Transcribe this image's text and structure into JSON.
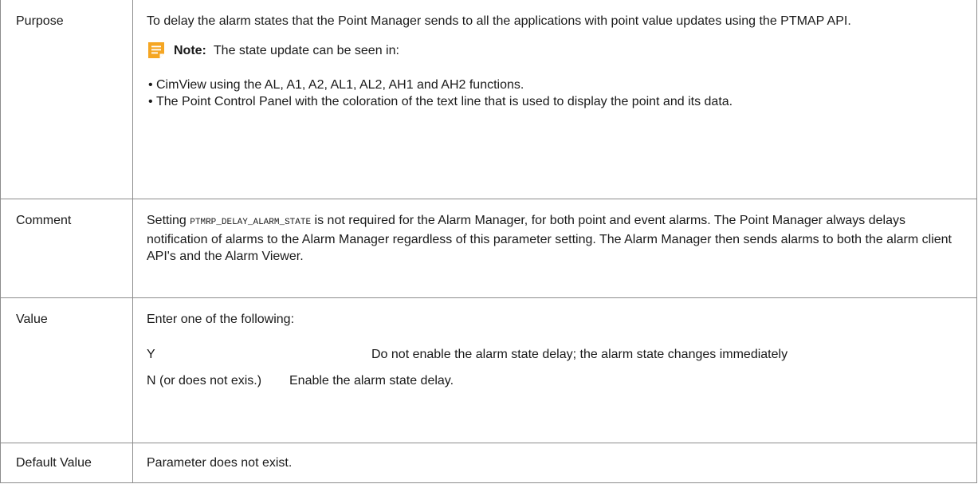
{
  "rows": {
    "purpose": {
      "label": "Purpose",
      "text": "To delay the alarm states that the Point Manager sends to all the applications with point value updates using the PTMAP API.",
      "note_label": "Note:",
      "note_text": "The state update can be seen in:",
      "note_icon": "note-icon",
      "note_icon_color": "#f5a623",
      "bullets": [
        "CimView using the AL, A1, A2, AL1, AL2, AH1 and  AH2 functions.",
        "The Point Control Panel with the coloration of the text line that is used to display the point and its data."
      ]
    },
    "comment": {
      "label": "Comment",
      "text_before": "Setting",
      "code": "PTMRP_DELAY_ALARM_STATE",
      "text_after": "is not required for the Alarm Manager, for both point and event alarms. The Point Manager always delays notification of alarms to the Alarm Manager regardless of this parameter setting. The Alarm Manager then sends alarms to both the alarm client API's and the Alarm Viewer."
    },
    "value": {
      "label": "Value",
      "intro": "Enter one of the following:",
      "options": [
        {
          "key": "Y",
          "desc": "Do not enable the alarm state delay; the alarm state changes immediately"
        },
        {
          "key": "N (or does not exis.)",
          "desc": "Enable the alarm state delay."
        }
      ]
    },
    "default": {
      "label": "Default Value",
      "text": "Parameter does not exist."
    }
  }
}
